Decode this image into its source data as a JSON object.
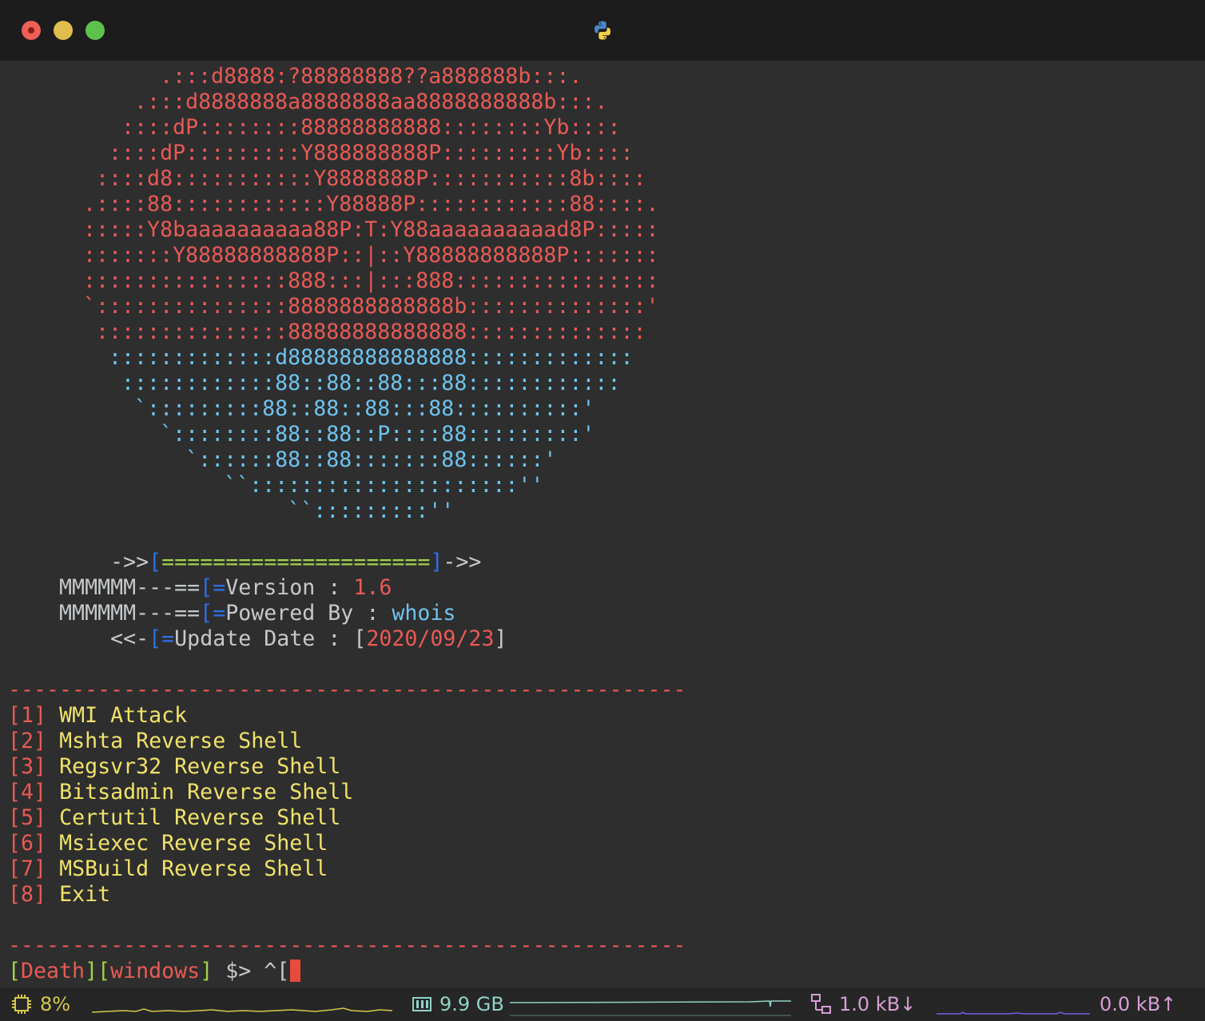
{
  "titlebar": {
    "app_icon": "python-icon",
    "colors": {
      "close": "#ee5f57",
      "minimize": "#e0bd4d",
      "maximize": "#5ec14b"
    }
  },
  "banner_art": {
    "red_lines": [
      "      .:::d8888:?88888888??a888888b:::.",
      "    .:::d8888888a8888888aa8888888888b:::.",
      "   ::::dP::::::::88888888888::::::::Yb::::",
      "  ::::dP:::::::::Y888888888P:::::::::Yb::::",
      " ::::d8:::::::::::Y8888888P:::::::::::8b::::",
      ".::::88::::::::::::Y88888P::::::::::::88::::.",
      ":::::Y8baaaaaaaaaa88P:T:Y88aaaaaaaaaad8P:::::",
      ":::::::Y88888888888P::|::Y88888888888P:::::::",
      "::::::::::::::::888:::|:::888::::::::::::::::",
      "`:::::::::::::::8888888888888b::::::::::::::'",
      " :::::::::::::::88888888888888::::::::::::::"
    ],
    "blue_lines": [
      "  :::::::::::::d88888888888888:::::::::::::",
      "   ::::::::::::88::88::88:::88::::::::::::",
      "    `:::::::::88::88::88:::88::::::::::'",
      "      `::::::::88::88::P::::88:::::::::'",
      "        `::::::88::88:::::::88::::::'",
      "           ``:::::::::::::::::::::''",
      "                ``:::::::::''"
    ]
  },
  "info": {
    "arrow_left": "->>",
    "bracket_open": "[",
    "equals_bar": "=====================",
    "bracket_close": "]",
    "arrow_right": "->>",
    "mmm": "MMMMMM---==",
    "eq": "=",
    "version_label": "Version : ",
    "version_value": "1.6",
    "powered_label": "Powered By : ",
    "powered_value": "whois",
    "update_prefix": "<<-",
    "update_label": "Update Date : ",
    "update_bracket_open": "[",
    "update_value": "2020/09/23",
    "update_bracket_close": "]"
  },
  "separator": "-----------------------------------------------------",
  "menu": [
    {
      "num": "[1]",
      "label": "WMI Attack"
    },
    {
      "num": "[2]",
      "label": "Mshta Reverse Shell"
    },
    {
      "num": "[3]",
      "label": "Regsvr32 Reverse Shell"
    },
    {
      "num": "[4]",
      "label": "Bitsadmin Reverse Shell"
    },
    {
      "num": "[5]",
      "label": "Certutil Reverse Shell"
    },
    {
      "num": "[6]",
      "label": "Msiexec Reverse Shell"
    },
    {
      "num": "[7]",
      "label": "MSBuild Reverse Shell"
    },
    {
      "num": "[8]",
      "label": "Exit"
    }
  ],
  "prompt": {
    "open1": "[",
    "user": "Death",
    "mid": "][",
    "host": "windows",
    "close1": "]",
    "symbol": " $> ",
    "input": "^["
  },
  "status_bar": {
    "cpu_icon": "cpu-icon",
    "cpu_value": "8%",
    "mem_icon": "memory-icon",
    "mem_value": "9.9 GB",
    "net_icon": "network-icon",
    "net_down": "1.0 kB↓",
    "net_up": "0.0 kB↑",
    "colors": {
      "cpu": "#d6c94a",
      "mem": "#8fd3c7",
      "net": "#d79fd6",
      "up_graph": "#6f62e8"
    }
  }
}
